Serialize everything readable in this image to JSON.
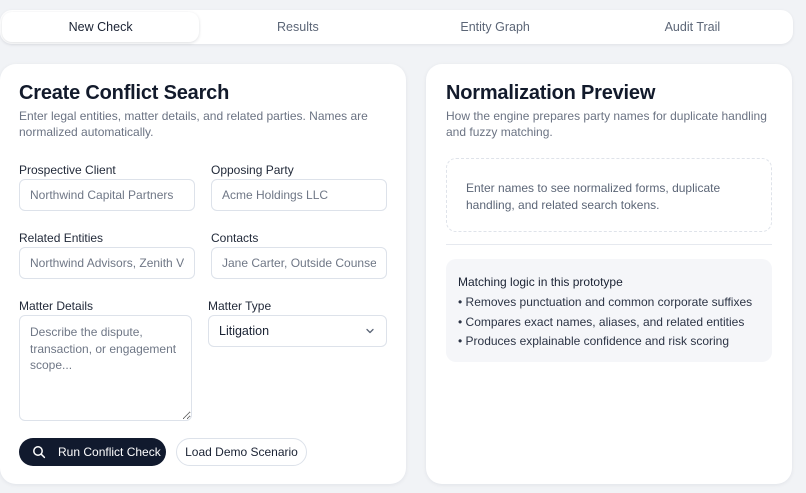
{
  "tabs": [
    {
      "label": "New Check",
      "active": true
    },
    {
      "label": "Results",
      "active": false
    },
    {
      "label": "Entity Graph",
      "active": false
    },
    {
      "label": "Audit Trail",
      "active": false
    }
  ],
  "create": {
    "title": "Create Conflict Search",
    "subtitle_line1": "Enter legal entities, matter details, and related parties. Names are",
    "subtitle_line2": "normalized automatically.",
    "prospective_client": {
      "label": "Prospective Client",
      "value": "",
      "placeholder": "Northwind Capital Partners"
    },
    "opposing_party": {
      "label": "Opposing Party",
      "value": "",
      "placeholder": "Acme Holdings LLC"
    },
    "related_entities": {
      "label": "Related Entities",
      "value": "",
      "placeholder": "Northwind Advisors, Zenith Ventures"
    },
    "contacts": {
      "label": "Contacts",
      "value": "",
      "placeholder": "Jane Carter, Outside Counsel"
    },
    "matter_details": {
      "label": "Matter Details",
      "value": "",
      "placeholder": "Describe the dispute, transaction, or engagement scope..."
    },
    "matter_type": {
      "label": "Matter Type",
      "selected": "Litigation"
    },
    "run_button": "Run Conflict Check",
    "demo_button": "Load Demo Scenario"
  },
  "preview": {
    "title": "Normalization Preview",
    "subtitle_line1": "How the engine prepares party names for duplicate handling",
    "subtitle_line2": "and fuzzy matching.",
    "empty_line1": "Enter names to see normalized forms, duplicate",
    "empty_line2": "handling, and related search tokens.",
    "logic_title": "Matching logic in this prototype",
    "logic_items": [
      "• Removes punctuation and common corporate suffixes",
      "• Compares exact names, aliases, and related entities",
      "• Produces explainable confidence and risk scoring"
    ]
  },
  "icons": {
    "run": "search-icon",
    "select": "chevron-down-icon"
  },
  "colors": {
    "primary": "#111a2e",
    "background": "#f1f3f6"
  }
}
